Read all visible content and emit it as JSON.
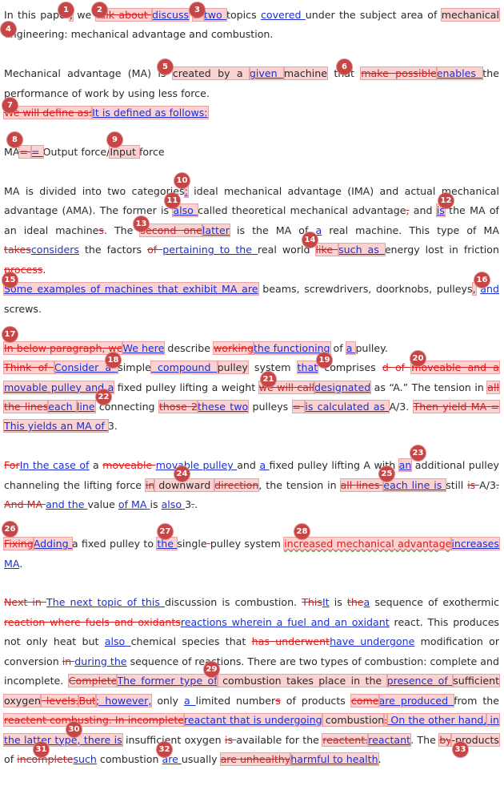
{
  "paragraphs": [
    {
      "segments": [
        {
          "t": "In this paper"
        },
        {
          "t": ",",
          "c": "hl"
        },
        {
          "t": " we "
        },
        {
          "t": "talk about ",
          "c": "del hl"
        },
        {
          "t": "discuss",
          "c": "ins hl"
        },
        {
          "t": " "
        },
        {
          "t": "2 ",
          "c": "del hl"
        },
        {
          "t": "two ",
          "c": "ins hl"
        },
        {
          "t": "topics "
        },
        {
          "t": "covered ",
          "c": "ins"
        },
        {
          "t": "under the subject area of "
        },
        {
          "t": "mechanical",
          "c": "hl"
        },
        {
          "t": " engineering: mechanical advantage and combustion."
        }
      ]
    },
    {
      "segments": [
        {
          "t": "Mechanical advantage (MA) is "
        },
        {
          "t": "created by a ",
          "c": "hl"
        },
        {
          "t": "given ",
          "c": "ins hl"
        },
        {
          "t": "machine",
          "c": "hl"
        },
        {
          "t": " that "
        },
        {
          "t": "make possible",
          "c": "del hl"
        },
        {
          "t": "enables ",
          "c": "ins hl"
        },
        {
          "t": "the performance of work by using less force."
        },
        {
          "br": true
        },
        {
          "t": "We will define as:",
          "c": "del hl"
        },
        {
          "t": "It is defined as follows: ",
          "c": "ins hl"
        }
      ]
    },
    {
      "segments": [
        {
          "t": "MA"
        },
        {
          "t": "= ",
          "c": "del hl"
        },
        {
          "t": " = ",
          "c": "ins hl"
        },
        {
          "t": "Output force/"
        },
        {
          "t": "Input ",
          "c": "hl"
        },
        {
          "t": "force"
        }
      ]
    },
    {
      "segments": [
        {
          "t": "MA is divided into two categories"
        },
        {
          "t": ":",
          "c": "ins hl"
        },
        {
          "t": " ideal mechanical advantage (IMA) and actual mechanical advantage (AMA). The former is "
        },
        {
          "t": "also ",
          "c": "ins hl"
        },
        {
          "t": "called theoretical mechanical advantage"
        },
        {
          "t": ",",
          "c": "del"
        },
        {
          "t": " and "
        },
        {
          "t": "is",
          "c": "ins hl"
        },
        {
          "t": " the MA of an ideal machine"
        },
        {
          "t": "s",
          "c": "del"
        },
        {
          "t": ". The "
        },
        {
          "t": "second one",
          "c": "del hl"
        },
        {
          "t": "latter",
          "c": "ins hl"
        },
        {
          "t": " is the MA of "
        },
        {
          "t": "a",
          "c": "ins"
        },
        {
          "t": " real machine. This type of MA "
        },
        {
          "t": "takes",
          "c": "del"
        },
        {
          "t": "considers",
          "c": "ins"
        },
        {
          "t": " the factors "
        },
        {
          "t": "of ",
          "c": "del"
        },
        {
          "t": "pertaining to the ",
          "c": "ins"
        },
        {
          "t": "real world "
        },
        {
          "t": "like ",
          "c": "del hl"
        },
        {
          "t": "such as ",
          "c": "ins hl"
        },
        {
          "t": "energy lost in friction "
        },
        {
          "t": "process",
          "c": "del"
        },
        {
          "t": "."
        },
        {
          "br": true
        },
        {
          "t": "Some examples of machines that exhibit MA are",
          "c": "ins hl"
        },
        {
          "t": " beams, screwdrivers, doorknobs, pulleys"
        },
        {
          "t": ",",
          "c": "hl"
        },
        {
          "t": " "
        },
        {
          "t": "and ",
          "c": "ins"
        },
        {
          "t": "screws."
        }
      ]
    },
    {
      "segments": [
        {
          "t": "In below paragraph, we",
          "c": "del hl"
        },
        {
          "t": "We here",
          "c": "ins hl"
        },
        {
          "t": " describe "
        },
        {
          "t": "working",
          "c": "del hl"
        },
        {
          "t": "the functioning",
          "c": "ins hl"
        },
        {
          "t": " of "
        },
        {
          "t": "a ",
          "c": "ins hl"
        },
        {
          "t": "pulley."
        },
        {
          "br": true
        },
        {
          "t": "Think of ",
          "c": "del hl"
        },
        {
          "t": "Consider a ",
          "c": "ins hl"
        },
        {
          "t": "simple"
        },
        {
          "t": " compound ",
          "c": "ins hl"
        },
        {
          "t": "pulley",
          "c": "hl"
        },
        {
          "t": " system "
        },
        {
          "t": "that",
          "c": "ins hl"
        },
        {
          "t": " comprises "
        },
        {
          "t": "d of ",
          "c": "del"
        },
        {
          "t": "moveable and a ",
          "c": "del hl"
        },
        {
          "t": "movable pulley and a",
          "c": "ins hl"
        },
        {
          "t": " fixed pulley lifting a weight "
        },
        {
          "t": "we will call",
          "c": "del hl"
        },
        {
          "t": "designated",
          "c": "ins hl"
        },
        {
          "t": " as “A.” The tension in "
        },
        {
          "t": "all the lines",
          "c": "del hl"
        },
        {
          "t": "each ",
          "c": "ins hl"
        },
        {
          "t": "line",
          "c": "ins hl"
        },
        {
          "t": " connecting "
        },
        {
          "t": "those 2",
          "c": "del hl"
        },
        {
          "t": "these two",
          "c": "ins hl"
        },
        {
          "t": " pulleys "
        },
        {
          "t": "= ",
          "c": "del hl"
        },
        {
          "t": "is calculated as ",
          "c": "ins hl"
        },
        {
          "t": "A/3. "
        },
        {
          "t": "Then yield MA = ",
          "c": "del hl"
        },
        {
          "t": "This yields an MA of ",
          "c": "ins hl"
        },
        {
          "t": "3."
        }
      ]
    },
    {
      "segments": [
        {
          "t": "For",
          "c": "del"
        },
        {
          "t": "In the case of",
          "c": "ins"
        },
        {
          "t": " a "
        },
        {
          "t": "moveable ",
          "c": "del"
        },
        {
          "t": "movable pulley ",
          "c": "ins"
        },
        {
          "t": "and "
        },
        {
          "t": "a ",
          "c": "ins"
        },
        {
          "t": "fixed pulley lifting A with "
        },
        {
          "t": "an",
          "c": "ins hl"
        },
        {
          "t": " additional pulley channeling the lifting force "
        },
        {
          "t": "in",
          "c": "del hl"
        },
        {
          "t": " downward ",
          "c": "hl"
        },
        {
          "t": "direction",
          "c": "del hl"
        },
        {
          "t": ", the tension in "
        },
        {
          "t": "all lines ",
          "c": "del hl"
        },
        {
          "t": "each line is ",
          "c": "ins hl"
        },
        {
          "t": "still "
        },
        {
          "t": "is ",
          "c": "del"
        },
        {
          "t": "A/3"
        },
        {
          "t": ". And MA ",
          "c": "del"
        },
        {
          "t": " and the ",
          "c": "ins"
        },
        {
          "t": "value "
        },
        {
          "t": "of MA ",
          "c": "ins"
        },
        {
          "t": "is "
        },
        {
          "t": "also ",
          "c": "ins"
        },
        {
          "t": "3"
        },
        {
          "t": ".",
          "c": "del"
        },
        {
          "t": "."
        }
      ]
    },
    {
      "segments": [
        {
          "t": "Fixing",
          "c": "del hl"
        },
        {
          "t": "Adding ",
          "c": "ins hl"
        },
        {
          "t": "a fixed pulley to "
        },
        {
          "t": "the ",
          "c": "ins hl"
        },
        {
          "t": "single"
        },
        {
          "t": " ",
          "c": "del"
        },
        {
          "t": " pulley system "
        },
        {
          "t": "increased mechanical advantage",
          "c": "del hl squiggle"
        },
        {
          "t": "increases ",
          "c": "ins hl"
        },
        {
          "t": "MA",
          "c": "ins"
        },
        {
          "t": "."
        }
      ]
    },
    {
      "segments": [
        {
          "t": "Next in ",
          "c": "del"
        },
        {
          "t": "The next topic of this ",
          "c": "ins"
        },
        {
          "t": "discussion is combustion. "
        },
        {
          "t": "This",
          "c": "del"
        },
        {
          "t": "It",
          "c": "ins"
        },
        {
          "t": " is "
        },
        {
          "t": "the",
          "c": "del"
        },
        {
          "t": "a",
          "c": "ins"
        },
        {
          "t": " sequence of exothermic "
        },
        {
          "t": "reaction where fuels and oxidants",
          "c": "del"
        },
        {
          "t": "reactions wherein a fuel and an oxidant",
          "c": "ins"
        },
        {
          "t": " react. This produces not only heat but "
        },
        {
          "t": "also ",
          "c": "ins"
        },
        {
          "t": "chemical species that "
        },
        {
          "t": "has underwent",
          "c": "del"
        },
        {
          "t": "have undergone",
          "c": "ins"
        },
        {
          "t": " modification or conversion "
        },
        {
          "t": "in ",
          "c": "del"
        },
        {
          "t": "during the",
          "c": "ins"
        },
        {
          "t": " sequence of reactions. There are two types of combustion: complete and incomplete. "
        },
        {
          "t": "Complete",
          "c": "del hl"
        },
        {
          "t": "The former type of",
          "c": "ins hl"
        },
        {
          "t": " combustion takes place in the ",
          "c": "hl"
        },
        {
          "t": "presence of ",
          "c": "ins hl"
        },
        {
          "t": "sufficient oxygen",
          "c": "hl"
        },
        {
          "t": " levels.",
          "c": "del hl"
        },
        {
          "t": "But",
          "c": "del hl"
        },
        {
          "t": "; however,",
          "c": "ins hl"
        },
        {
          "t": " only "
        },
        {
          "t": "a ",
          "c": "ins"
        },
        {
          "t": "limited number"
        },
        {
          "t": "s",
          "c": "del"
        },
        {
          "t": " of products "
        },
        {
          "t": "come",
          "c": "del hl"
        },
        {
          "t": "are produced ",
          "c": "ins hl"
        },
        {
          "t": "from the "
        },
        {
          "t": "reactent combusting.  In incomplete",
          "c": "del hl"
        },
        {
          "t": "reactant that is undergoing",
          "c": "ins hl"
        },
        {
          "t": " combustion",
          "c": "hl"
        },
        {
          "t": ".",
          "c": "del hl"
        },
        {
          "t": " On the other hand,",
          "c": "ins hl"
        },
        {
          "t": " in the latter type, there is",
          "c": "ins hl"
        },
        {
          "t": " insufficient oxygen "
        },
        {
          "t": "is ",
          "c": "del"
        },
        {
          "t": "available for the "
        },
        {
          "t": "reactent.",
          "c": "del hl"
        },
        {
          "t": "reactant",
          "c": "ins hl"
        },
        {
          "t": ". The "
        },
        {
          "t": "by",
          "c": "del hl"
        },
        {
          "t": "-products",
          "c": "hl"
        },
        {
          "t": " of "
        },
        {
          "t": "incomplete",
          "c": "del"
        },
        {
          "t": "such",
          "c": "ins"
        },
        {
          "t": " combustion "
        },
        {
          "t": "are ",
          "c": "ins"
        },
        {
          "t": "usually "
        },
        {
          "t": "are unhealthy",
          "c": "del hl"
        },
        {
          "t": "harmful to health",
          "c": "ins hl"
        },
        {
          "t": "."
        }
      ]
    }
  ],
  "markers": [
    "1",
    "2",
    "3",
    "4",
    "5",
    "6",
    "7",
    "8",
    "9",
    "10",
    "11",
    "12",
    "13",
    "14",
    "15",
    "16",
    "17",
    "18",
    "19",
    "20",
    "21",
    "22",
    "23",
    "24",
    "25",
    "26",
    "27",
    "28",
    "29",
    "30",
    "31",
    "32",
    "33"
  ]
}
